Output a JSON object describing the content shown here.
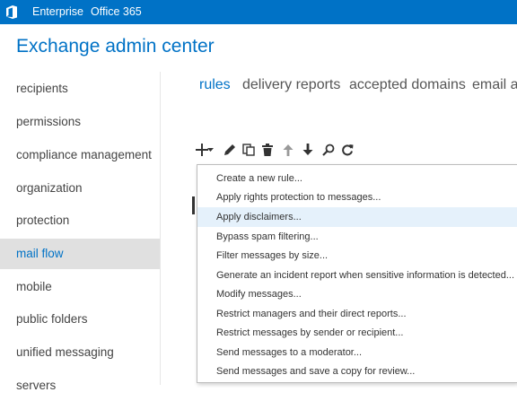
{
  "topbar": {
    "logo_icon": "office-logo-icon",
    "nav": [
      "Enterprise",
      "Office 365"
    ],
    "background": "#0072c6"
  },
  "app_title": "Exchange admin center",
  "sidebar": {
    "items": [
      {
        "label": "recipients"
      },
      {
        "label": "permissions"
      },
      {
        "label": "compliance management"
      },
      {
        "label": "organization"
      },
      {
        "label": "protection"
      },
      {
        "label": "mail flow",
        "selected": true
      },
      {
        "label": "mobile"
      },
      {
        "label": "public folders"
      },
      {
        "label": "unified messaging"
      },
      {
        "label": "servers"
      }
    ]
  },
  "tabs": [
    {
      "label": "rules",
      "active": true
    },
    {
      "label": "delivery reports"
    },
    {
      "label": "accepted domains"
    },
    {
      "label": "email address policies"
    }
  ],
  "toolbar": {
    "icons": [
      "add-icon",
      "dropdown-arrow-icon",
      "edit-icon",
      "copy-icon",
      "delete-icon",
      "move-up-icon",
      "move-down-icon",
      "search-icon",
      "refresh-icon"
    ]
  },
  "new_rule_menu": {
    "items": [
      {
        "label": "Create a new rule..."
      },
      {
        "label": "Apply rights protection to messages..."
      },
      {
        "label": "Apply disclaimers...",
        "hovered": true
      },
      {
        "label": "Bypass spam filtering..."
      },
      {
        "label": "Filter messages by size..."
      },
      {
        "label": "Generate an incident report when sensitive information is detected..."
      },
      {
        "label": "Modify messages..."
      },
      {
        "label": "Restrict managers and their direct reports..."
      },
      {
        "label": "Restrict messages by sender or recipient..."
      },
      {
        "label": "Send messages to a moderator..."
      },
      {
        "label": "Send messages and save a copy for review..."
      }
    ]
  },
  "colors": {
    "accent": "#0072c6",
    "selected_bg": "#e0e0e0",
    "hover_bg": "#e5f1fb"
  }
}
